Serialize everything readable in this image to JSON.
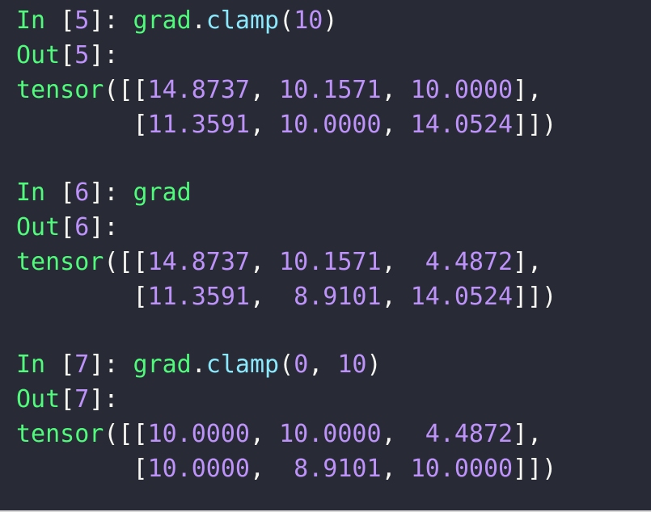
{
  "colors": {
    "background": "#282a36",
    "prompt_green": "#50fa7b",
    "number_purple": "#bd93f9",
    "method_cyan": "#8be9fd",
    "punct_white": "#f8f8f2"
  },
  "cells": [
    {
      "in_label": "In",
      "number": "5",
      "code_var": "grad",
      "code_method": "clamp",
      "code_args": [
        "10"
      ],
      "out_label": "Out",
      "result_fn": "tensor",
      "rows": [
        [
          "14.8737",
          "10.1571",
          "10.0000"
        ],
        [
          "11.3591",
          "10.0000",
          "14.0524"
        ]
      ]
    },
    {
      "in_label": "In",
      "number": "6",
      "code_var": "grad",
      "out_label": "Out",
      "result_fn": "tensor",
      "rows": [
        [
          "14.8737",
          "10.1571",
          " 4.4872"
        ],
        [
          "11.3591",
          " 8.9101",
          "14.0524"
        ]
      ]
    },
    {
      "in_label": "In",
      "number": "7",
      "code_var": "grad",
      "code_method": "clamp",
      "code_args": [
        "0",
        "10"
      ],
      "out_label": "Out",
      "result_fn": "tensor",
      "rows": [
        [
          "10.0000",
          "10.0000",
          " 4.4872"
        ],
        [
          "10.0000",
          " 8.9101",
          "10.0000"
        ]
      ]
    }
  ]
}
